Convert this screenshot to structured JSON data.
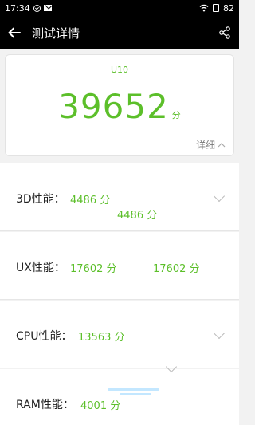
{
  "status_bar": {
    "time": "17:34",
    "battery": "82"
  },
  "app_bar": {
    "title": "测试详情"
  },
  "score_card": {
    "device": "U10",
    "score": "39652",
    "unit": "分",
    "detail_label": "详细"
  },
  "rows": [
    {
      "label": "3D性能：",
      "value": "4486 分",
      "ghost": "4486 分"
    },
    {
      "label": "UX性能：",
      "value": "17602 分",
      "ghost": "17602 分"
    },
    {
      "label": "CPU性能：",
      "value": "13563 分"
    },
    {
      "label": "RAM性能：",
      "value": "4001 分"
    }
  ],
  "colors": {
    "accent": "#5cbf2a",
    "app_bar": "#000000"
  },
  "icons": [
    "back-arrow-icon",
    "share-icon",
    "chevron-up-icon",
    "chevron-down-icon"
  ]
}
